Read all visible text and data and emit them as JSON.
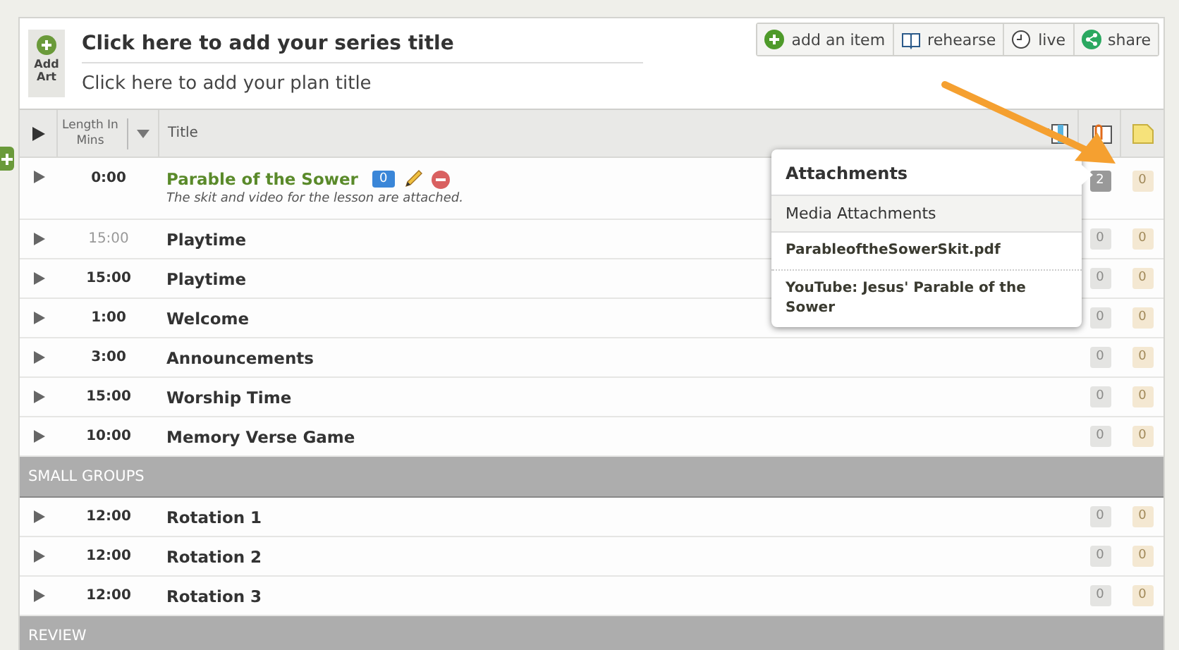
{
  "header": {
    "add_art_label": "Add Art",
    "series_title": "Click here to add your series title",
    "plan_title": "Click here to add your plan title"
  },
  "toolbar": [
    {
      "kind": "add",
      "label": "add an item"
    },
    {
      "kind": "book",
      "label": "rehearse"
    },
    {
      "kind": "clock",
      "label": "live"
    },
    {
      "kind": "share",
      "label": "share"
    }
  ],
  "table": {
    "columns": [
      "Length In Mins",
      "Title"
    ],
    "rows": [
      {
        "kind": "item",
        "time": "0:00",
        "time_dimmed": false,
        "title": "Parable of the Sower",
        "featured": true,
        "comments": "0",
        "description": "The skit and video for the lesson are attached.",
        "attachments": "2",
        "attachments_active": true,
        "notes": "0"
      },
      {
        "kind": "item",
        "time": "15:00",
        "time_dimmed": true,
        "title": "Playtime",
        "featured": false,
        "attachments": "0",
        "attachments_active": false,
        "notes": "0"
      },
      {
        "kind": "item",
        "time": "15:00",
        "time_dimmed": false,
        "title": "Playtime",
        "featured": false,
        "attachments": "0",
        "attachments_active": false,
        "notes": "0"
      },
      {
        "kind": "item",
        "time": "1:00",
        "time_dimmed": false,
        "title": "Welcome",
        "featured": false,
        "attachments": "0",
        "attachments_active": false,
        "notes": "0"
      },
      {
        "kind": "item",
        "time": "3:00",
        "time_dimmed": false,
        "title": "Announcements",
        "featured": false,
        "attachments": "0",
        "attachments_active": false,
        "notes": "0"
      },
      {
        "kind": "item",
        "time": "15:00",
        "time_dimmed": false,
        "title": "Worship Time",
        "featured": false,
        "attachments": "0",
        "attachments_active": false,
        "notes": "0"
      },
      {
        "kind": "item",
        "time": "10:00",
        "time_dimmed": false,
        "title": "Memory Verse Game",
        "featured": false,
        "attachments": "0",
        "attachments_active": false,
        "notes": "0"
      },
      {
        "kind": "section",
        "title": "SMALL GROUPS"
      },
      {
        "kind": "item",
        "time": "12:00",
        "time_dimmed": false,
        "title": "Rotation 1",
        "featured": false,
        "attachments": "0",
        "attachments_active": false,
        "notes": "0"
      },
      {
        "kind": "item",
        "time": "12:00",
        "time_dimmed": false,
        "title": "Rotation 2",
        "featured": false,
        "attachments": "0",
        "attachments_active": false,
        "notes": "0"
      },
      {
        "kind": "item",
        "time": "12:00",
        "time_dimmed": false,
        "title": "Rotation 3",
        "featured": false,
        "attachments": "0",
        "attachments_active": false,
        "notes": "0"
      },
      {
        "kind": "section",
        "title": "REVIEW"
      }
    ]
  },
  "popover": {
    "title": "Attachments",
    "section": "Media Attachments",
    "items": [
      "ParableoftheSowerSkit.pdf",
      "YouTube: Jesus' Parable of the Sower"
    ]
  }
}
